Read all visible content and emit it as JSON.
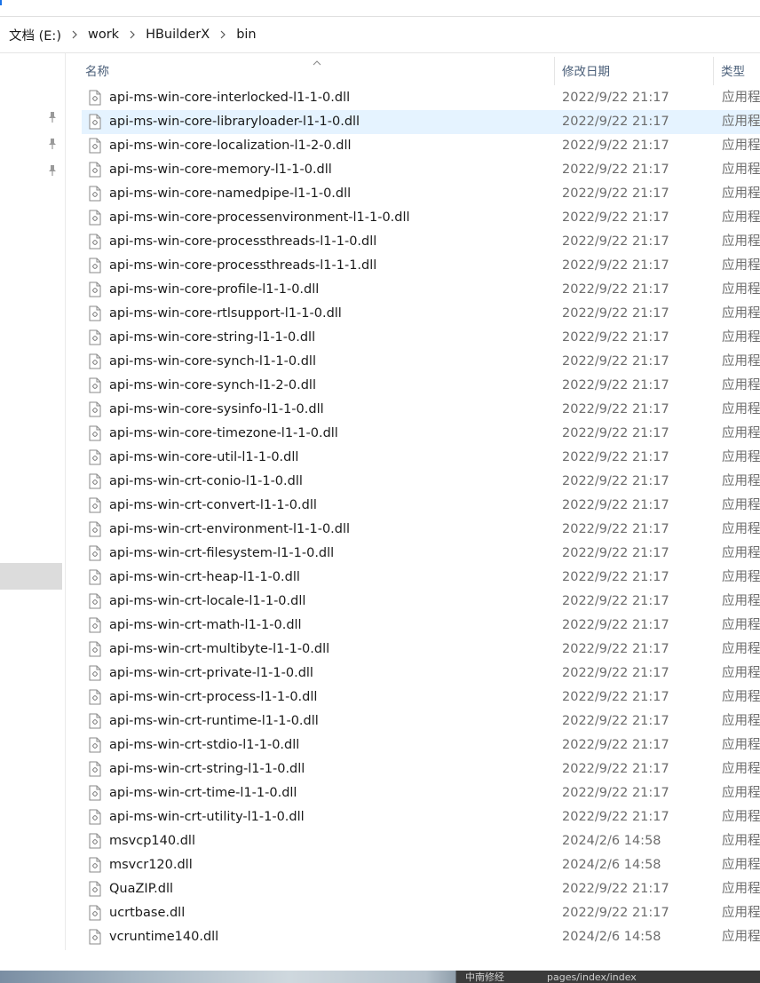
{
  "breadcrumb": [
    {
      "label": "文档 (E:)"
    },
    {
      "label": "work"
    },
    {
      "label": "HBuilderX"
    },
    {
      "label": "bin"
    }
  ],
  "columns": {
    "name": "名称",
    "date": "修改日期",
    "type": "类型"
  },
  "selected_index": 1,
  "files": [
    {
      "name": "api-ms-win-core-interlocked-l1-1-0.dll",
      "date": "2022/9/22 21:17",
      "type": "应用程"
    },
    {
      "name": "api-ms-win-core-libraryloader-l1-1-0.dll",
      "date": "2022/9/22 21:17",
      "type": "应用程"
    },
    {
      "name": "api-ms-win-core-localization-l1-2-0.dll",
      "date": "2022/9/22 21:17",
      "type": "应用程"
    },
    {
      "name": "api-ms-win-core-memory-l1-1-0.dll",
      "date": "2022/9/22 21:17",
      "type": "应用程"
    },
    {
      "name": "api-ms-win-core-namedpipe-l1-1-0.dll",
      "date": "2022/9/22 21:17",
      "type": "应用程"
    },
    {
      "name": "api-ms-win-core-processenvironment-l1-1-0.dll",
      "date": "2022/9/22 21:17",
      "type": "应用程"
    },
    {
      "name": "api-ms-win-core-processthreads-l1-1-0.dll",
      "date": "2022/9/22 21:17",
      "type": "应用程"
    },
    {
      "name": "api-ms-win-core-processthreads-l1-1-1.dll",
      "date": "2022/9/22 21:17",
      "type": "应用程"
    },
    {
      "name": "api-ms-win-core-profile-l1-1-0.dll",
      "date": "2022/9/22 21:17",
      "type": "应用程"
    },
    {
      "name": "api-ms-win-core-rtlsupport-l1-1-0.dll",
      "date": "2022/9/22 21:17",
      "type": "应用程"
    },
    {
      "name": "api-ms-win-core-string-l1-1-0.dll",
      "date": "2022/9/22 21:17",
      "type": "应用程"
    },
    {
      "name": "api-ms-win-core-synch-l1-1-0.dll",
      "date": "2022/9/22 21:17",
      "type": "应用程"
    },
    {
      "name": "api-ms-win-core-synch-l1-2-0.dll",
      "date": "2022/9/22 21:17",
      "type": "应用程"
    },
    {
      "name": "api-ms-win-core-sysinfo-l1-1-0.dll",
      "date": "2022/9/22 21:17",
      "type": "应用程"
    },
    {
      "name": "api-ms-win-core-timezone-l1-1-0.dll",
      "date": "2022/9/22 21:17",
      "type": "应用程"
    },
    {
      "name": "api-ms-win-core-util-l1-1-0.dll",
      "date": "2022/9/22 21:17",
      "type": "应用程"
    },
    {
      "name": "api-ms-win-crt-conio-l1-1-0.dll",
      "date": "2022/9/22 21:17",
      "type": "应用程"
    },
    {
      "name": "api-ms-win-crt-convert-l1-1-0.dll",
      "date": "2022/9/22 21:17",
      "type": "应用程"
    },
    {
      "name": "api-ms-win-crt-environment-l1-1-0.dll",
      "date": "2022/9/22 21:17",
      "type": "应用程"
    },
    {
      "name": "api-ms-win-crt-filesystem-l1-1-0.dll",
      "date": "2022/9/22 21:17",
      "type": "应用程"
    },
    {
      "name": "api-ms-win-crt-heap-l1-1-0.dll",
      "date": "2022/9/22 21:17",
      "type": "应用程"
    },
    {
      "name": "api-ms-win-crt-locale-l1-1-0.dll",
      "date": "2022/9/22 21:17",
      "type": "应用程"
    },
    {
      "name": "api-ms-win-crt-math-l1-1-0.dll",
      "date": "2022/9/22 21:17",
      "type": "应用程"
    },
    {
      "name": "api-ms-win-crt-multibyte-l1-1-0.dll",
      "date": "2022/9/22 21:17",
      "type": "应用程"
    },
    {
      "name": "api-ms-win-crt-private-l1-1-0.dll",
      "date": "2022/9/22 21:17",
      "type": "应用程"
    },
    {
      "name": "api-ms-win-crt-process-l1-1-0.dll",
      "date": "2022/9/22 21:17",
      "type": "应用程"
    },
    {
      "name": "api-ms-win-crt-runtime-l1-1-0.dll",
      "date": "2022/9/22 21:17",
      "type": "应用程"
    },
    {
      "name": "api-ms-win-crt-stdio-l1-1-0.dll",
      "date": "2022/9/22 21:17",
      "type": "应用程"
    },
    {
      "name": "api-ms-win-crt-string-l1-1-0.dll",
      "date": "2022/9/22 21:17",
      "type": "应用程"
    },
    {
      "name": "api-ms-win-crt-time-l1-1-0.dll",
      "date": "2022/9/22 21:17",
      "type": "应用程"
    },
    {
      "name": "api-ms-win-crt-utility-l1-1-0.dll",
      "date": "2022/9/22 21:17",
      "type": "应用程"
    },
    {
      "name": "msvcp140.dll",
      "date": "2024/2/6 14:58",
      "type": "应用程"
    },
    {
      "name": "msvcr120.dll",
      "date": "2024/2/6 14:58",
      "type": "应用程"
    },
    {
      "name": "QuaZIP.dll",
      "date": "2022/9/22 21:17",
      "type": "应用程"
    },
    {
      "name": "ucrtbase.dll",
      "date": "2022/9/22 21:17",
      "type": "应用程"
    },
    {
      "name": "vcruntime140.dll",
      "date": "2024/2/6 14:58",
      "type": "应用程"
    }
  ],
  "taskbar": {
    "left_fragment": "中南修经",
    "right_fragment": "pages/index/index"
  },
  "icons": {
    "breadcrumb_separator": "chevron-right-icon",
    "pin": "pin-icon",
    "sort": "sort-ascending-icon",
    "file": "dll-file-icon"
  },
  "colors": {
    "selection": "#e5f3ff",
    "header_text": "#4c607a",
    "secondary_text": "#6d6d6d"
  }
}
